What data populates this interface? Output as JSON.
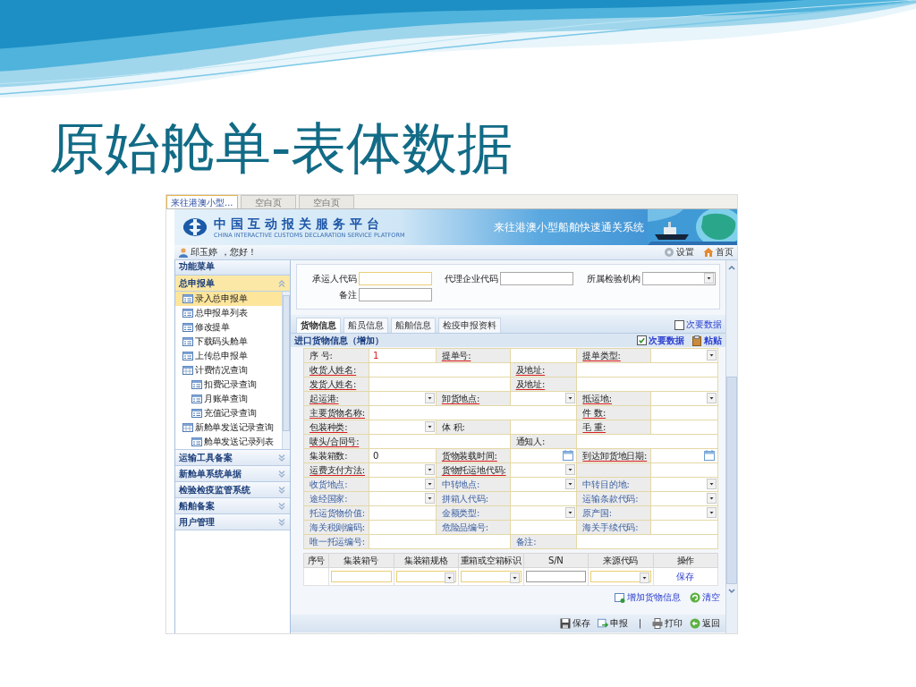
{
  "slide": {
    "title": "原始舱单-表体数据"
  },
  "browser_tabs": [
    {
      "label": "来往港澳小型...",
      "selected": true
    },
    {
      "label": "空白页",
      "selected": false
    },
    {
      "label": "空白页",
      "selected": false
    }
  ],
  "header": {
    "platform_name": "中国互动报关服务平台",
    "platform_name_en": "CHINA INTERACTIVE CUSTOMS DECLARATION SERVICE PLATFORM",
    "system_name": "来往港澳小型船舶快速通关系统"
  },
  "user_bar": {
    "user": "邱玉婷",
    "greeting": "，您好！",
    "links": [
      {
        "label": "设置",
        "kind": "settings"
      },
      {
        "label": "首页",
        "kind": "home"
      }
    ]
  },
  "sidebar": {
    "title": "功能菜单",
    "sections": [
      {
        "label": "总申报单",
        "expanded": true,
        "items": [
          {
            "label": "录入总申报单",
            "kind": "form",
            "selected": true
          },
          {
            "label": "总申报单列表",
            "kind": "form",
            "selected": false
          },
          {
            "label": "修改提单",
            "kind": "form",
            "selected": false
          },
          {
            "label": "下载码头舱单",
            "kind": "form",
            "selected": false
          },
          {
            "label": "上传总申报单",
            "kind": "form",
            "selected": false
          },
          {
            "label": "计费情况查询",
            "kind": "folder",
            "selected": false,
            "children": [
              {
                "label": "扣费记录查询",
                "kind": "form",
                "selected": false
              },
              {
                "label": "月账单查询",
                "kind": "form",
                "selected": false
              },
              {
                "label": "充值记录查询",
                "kind": "form",
                "selected": false
              }
            ]
          },
          {
            "label": "新舱单发送记录查询",
            "kind": "folder",
            "selected": false,
            "children": [
              {
                "label": "舱单发送记录列表",
                "kind": "form",
                "selected": false
              }
            ]
          }
        ]
      },
      {
        "label": "运输工具备案",
        "expanded": false
      },
      {
        "label": "新舱单系统单据",
        "expanded": false
      },
      {
        "label": "检验检疫监管系统",
        "expanded": false
      },
      {
        "label": "船舶备案",
        "expanded": false
      },
      {
        "label": "用户管理",
        "expanded": false
      }
    ]
  },
  "header_form": {
    "rows": [
      [
        {
          "label": "承运人代码",
          "kind": "text"
        },
        {
          "label": "代理企业代码",
          "kind": "text"
        },
        {
          "label": "所属检验机构",
          "kind": "select"
        }
      ],
      [
        {
          "label": "备注",
          "kind": "text"
        }
      ]
    ]
  },
  "detail_tabs": {
    "tabs": [
      {
        "label": "货物信息",
        "selected": true
      },
      {
        "label": "船员信息",
        "selected": false
      },
      {
        "label": "船舶信息",
        "selected": false
      },
      {
        "label": "检疫申报资料",
        "selected": false
      }
    ],
    "secondary_toggle": {
      "label": "次要数据",
      "checked": false
    }
  },
  "section": {
    "title": "进口货物信息（增加）",
    "secondary_toggle": {
      "label": "次要数据",
      "checked": true
    },
    "paste": {
      "label": "粘贴"
    }
  },
  "main_rows": [
    [
      {
        "kind": "label",
        "text": "序 号:",
        "required": false
      },
      {
        "kind": "text",
        "value": "1",
        "emphasis": true
      },
      {
        "kind": "label",
        "text": "提单号:",
        "required": true
      },
      {
        "kind": "text"
      },
      {
        "kind": "label",
        "text": "提单类型:",
        "required": true
      },
      {
        "kind": "select"
      }
    ],
    [
      {
        "kind": "label",
        "text": "收货人姓名:",
        "required": true
      },
      {
        "kind": "wide-text"
      },
      {
        "kind": "label",
        "text": "及地址:",
        "required": true
      },
      {
        "kind": "wide-text"
      }
    ],
    [
      {
        "kind": "label",
        "text": "发货人姓名:",
        "required": true
      },
      {
        "kind": "wide-text"
      },
      {
        "kind": "label",
        "text": "及地址:",
        "required": true
      },
      {
        "kind": "wide-text"
      }
    ],
    [
      {
        "kind": "label",
        "text": "起运港:",
        "required": true
      },
      {
        "kind": "select"
      },
      {
        "kind": "label",
        "text": "卸货地点:",
        "required": true
      },
      {
        "kind": "select"
      },
      {
        "kind": "label",
        "text": "抵运地:",
        "required": true
      },
      {
        "kind": "select"
      }
    ],
    [
      {
        "kind": "label",
        "text": "主要货物名称:",
        "required": true
      },
      {
        "kind": "long-text"
      },
      {
        "kind": "label",
        "text": "件 数:",
        "required": true
      },
      {
        "kind": "text"
      }
    ],
    [
      {
        "kind": "label",
        "text": "包装种类:",
        "required": true
      },
      {
        "kind": "select"
      },
      {
        "kind": "label",
        "text": "体 积:",
        "required": false
      },
      {
        "kind": "text"
      },
      {
        "kind": "label",
        "text": "毛 重:",
        "required": true
      },
      {
        "kind": "text"
      }
    ],
    [
      {
        "kind": "label",
        "text": "唛头/合同号:",
        "required": true
      },
      {
        "kind": "wide-text"
      },
      {
        "kind": "label",
        "text": "通知人:",
        "required": false
      },
      {
        "kind": "wide-text"
      }
    ],
    [
      {
        "kind": "label",
        "text": "集装箱数:",
        "required": false
      },
      {
        "kind": "text",
        "value": "0",
        "emphasis": false
      },
      {
        "kind": "label",
        "text": "货物装载时间:",
        "required": true
      },
      {
        "kind": "date"
      },
      {
        "kind": "label",
        "text": "到达卸货地日期:",
        "required": true
      },
      {
        "kind": "date"
      }
    ],
    [
      {
        "kind": "label",
        "text": "运费支付方法:",
        "required": true
      },
      {
        "kind": "select"
      },
      {
        "kind": "label",
        "text": "货物托运地代码:",
        "required": true
      },
      {
        "kind": "select"
      },
      {
        "kind": "blank"
      },
      {
        "kind": "text"
      }
    ]
  ],
  "secondary_rows": [
    [
      {
        "kind": "label",
        "text": "收货地点:",
        "required": false
      },
      {
        "kind": "select"
      },
      {
        "kind": "label",
        "text": "中转地点:",
        "required": false
      },
      {
        "kind": "select"
      },
      {
        "kind": "label",
        "text": "中转目的地:",
        "required": false
      },
      {
        "kind": "select"
      }
    ],
    [
      {
        "kind": "label",
        "text": "途经国家:",
        "required": false
      },
      {
        "kind": "select"
      },
      {
        "kind": "label",
        "text": "拼箱人代码:",
        "required": false
      },
      {
        "kind": "text"
      },
      {
        "kind": "label",
        "text": "运输条款代码:",
        "required": false
      },
      {
        "kind": "select"
      }
    ],
    [
      {
        "kind": "label",
        "text": "托运货物价值:",
        "required": false
      },
      {
        "kind": "text"
      },
      {
        "kind": "label",
        "text": "金额类型:",
        "required": false
      },
      {
        "kind": "select"
      },
      {
        "kind": "label",
        "text": "原产国:",
        "required": false
      },
      {
        "kind": "select"
      }
    ],
    [
      {
        "kind": "label",
        "text": "海关税则编码:",
        "required": false
      },
      {
        "kind": "text"
      },
      {
        "kind": "label",
        "text": "危险品编号:",
        "required": false
      },
      {
        "kind": "text"
      },
      {
        "kind": "label",
        "text": "海关手续代码:",
        "required": false
      },
      {
        "kind": "text"
      }
    ],
    [
      {
        "kind": "label",
        "text": "唯一托运编号:",
        "required": false
      },
      {
        "kind": "wide-text"
      },
      {
        "kind": "label",
        "text": "备注:",
        "required": false
      },
      {
        "kind": "wide-text"
      }
    ]
  ],
  "container_table": {
    "columns": [
      "序号",
      "集装箱号",
      "集装箱规格",
      "重箱或空箱标识",
      "S/N",
      "来源代码",
      "操作"
    ],
    "row": [
      {
        "kind": "empty"
      },
      {
        "kind": "text"
      },
      {
        "kind": "select"
      },
      {
        "kind": "select"
      },
      {
        "kind": "text"
      },
      {
        "kind": "select"
      },
      {
        "kind": "link",
        "text": "保存"
      }
    ]
  },
  "actions": [
    {
      "label": "增加货物信息",
      "kind": "add"
    },
    {
      "label": "清空",
      "kind": "clear"
    }
  ],
  "toolbar": [
    {
      "label": "保存",
      "kind": "save"
    },
    {
      "label": "申报",
      "kind": "submit"
    },
    {
      "label": "|",
      "kind": "separator"
    },
    {
      "label": "打印",
      "kind": "print"
    },
    {
      "label": "返回",
      "kind": "back"
    }
  ]
}
